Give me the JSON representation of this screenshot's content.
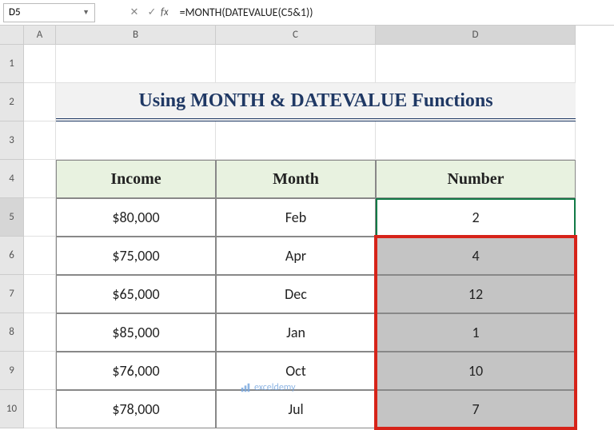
{
  "name_box": "D5",
  "formula": "=MONTH(DATEVALUE(C5&1))",
  "col_headers": {
    "A": "A",
    "B": "B",
    "C": "C",
    "D": "D"
  },
  "row_headers": [
    "1",
    "2",
    "3",
    "4",
    "5",
    "6",
    "7",
    "8",
    "9",
    "10"
  ],
  "title": "Using MONTH & DATEVALUE Functions",
  "headers": {
    "income": "Income",
    "month": "Month",
    "number": "Number"
  },
  "rows": [
    {
      "income": "$80,000",
      "month": "Feb",
      "number": "2"
    },
    {
      "income": "$75,000",
      "month": "Apr",
      "number": "4"
    },
    {
      "income": "$65,000",
      "month": "Dec",
      "number": "12"
    },
    {
      "income": "$85,000",
      "month": "Jan",
      "number": "1"
    },
    {
      "income": "$76,000",
      "month": "Oct",
      "number": "10"
    },
    {
      "income": "$78,000",
      "month": "Jul",
      "number": "7"
    }
  ],
  "watermark": "exceldemy"
}
